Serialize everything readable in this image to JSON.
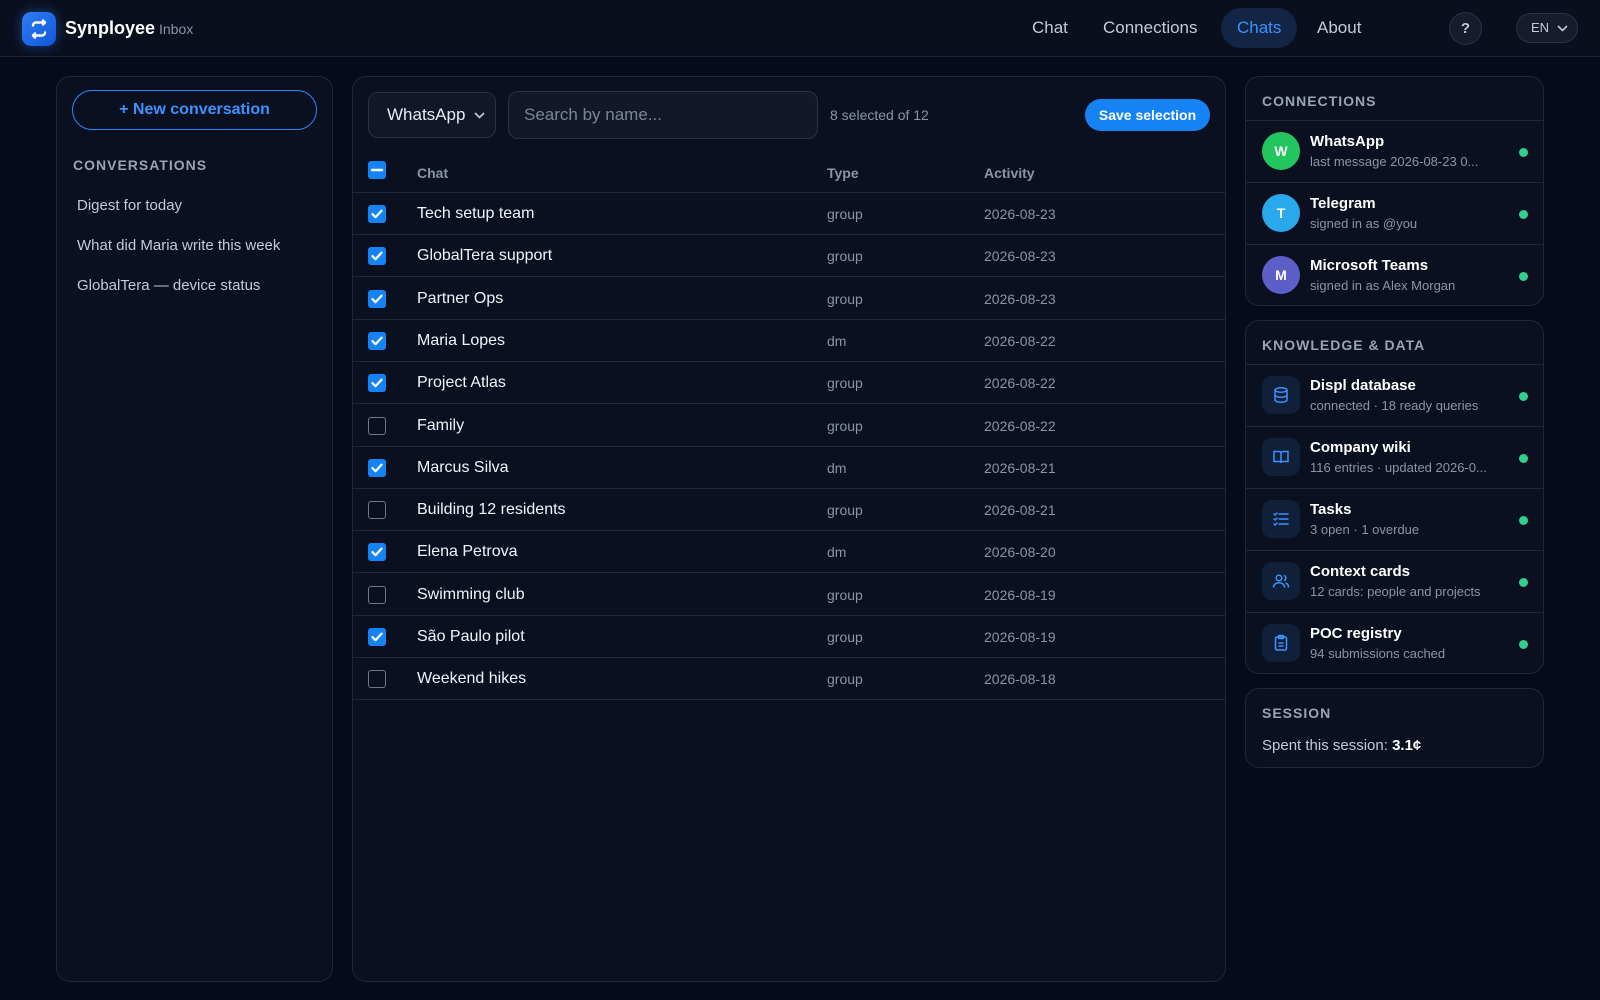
{
  "app": {
    "brand": "Synployee",
    "section": "Inbox"
  },
  "nav": {
    "items": [
      {
        "label": "Chat"
      },
      {
        "label": "Connections"
      },
      {
        "label": "Chats",
        "active": true
      },
      {
        "label": "About"
      }
    ],
    "help_label": "?",
    "lang_label": "EN"
  },
  "left": {
    "new_conversation_label": "+ New conversation",
    "conversations_title": "CONVERSATIONS",
    "conversations": [
      "Digest for today",
      "What did Maria write this week",
      "GlobalTera — device status"
    ]
  },
  "chats": {
    "platform_selected": "WhatsApp",
    "search_placeholder": "Search by name...",
    "selection_text": "8 selected of 12",
    "save_label": "Save selection",
    "columns": {
      "chat": "Chat",
      "type": "Type",
      "activity": "Activity"
    },
    "rows": [
      {
        "name": "Tech setup team",
        "type": "group",
        "activity": "2026-08-23",
        "checked": true
      },
      {
        "name": "GlobalTera support",
        "type": "group",
        "activity": "2026-08-23",
        "checked": true
      },
      {
        "name": "Partner Ops",
        "type": "group",
        "activity": "2026-08-23",
        "checked": true
      },
      {
        "name": "Maria Lopes",
        "type": "dm",
        "activity": "2026-08-22",
        "checked": true
      },
      {
        "name": "Project Atlas",
        "type": "group",
        "activity": "2026-08-22",
        "checked": true
      },
      {
        "name": "Family",
        "type": "group",
        "activity": "2026-08-22",
        "checked": false
      },
      {
        "name": "Marcus Silva",
        "type": "dm",
        "activity": "2026-08-21",
        "checked": true
      },
      {
        "name": "Building 12 residents",
        "type": "group",
        "activity": "2026-08-21",
        "checked": false
      },
      {
        "name": "Elena Petrova",
        "type": "dm",
        "activity": "2026-08-20",
        "checked": true
      },
      {
        "name": "Swimming club",
        "type": "group",
        "activity": "2026-08-19",
        "checked": false
      },
      {
        "name": "São Paulo pilot",
        "type": "group",
        "activity": "2026-08-19",
        "checked": true
      },
      {
        "name": "Weekend hikes",
        "type": "group",
        "activity": "2026-08-18",
        "checked": false
      }
    ]
  },
  "connections": {
    "title": "CONNECTIONS",
    "items": [
      {
        "initial": "W",
        "name": "WhatsApp",
        "detail": "last message 2026-08-23 0...",
        "color": "#22c55e"
      },
      {
        "initial": "T",
        "name": "Telegram",
        "detail": "signed in as @you",
        "color": "#29a9eb"
      },
      {
        "initial": "M",
        "name": "Microsoft Teams",
        "detail": "signed in as Alex Morgan",
        "color": "#5b5fc7"
      }
    ]
  },
  "knowledge": {
    "title": "KNOWLEDGE & DATA",
    "items": [
      {
        "icon": "database-icon",
        "name": "Displ database",
        "detail": "connected · 18 ready queries"
      },
      {
        "icon": "book-icon",
        "name": "Company wiki",
        "detail": "116 entries · updated 2026-0..."
      },
      {
        "icon": "list-icon",
        "name": "Tasks",
        "detail": "3 open · 1 overdue"
      },
      {
        "icon": "people-icon",
        "name": "Context cards",
        "detail": "12 cards: people and projects"
      },
      {
        "icon": "clipboard-icon",
        "name": "POC registry",
        "detail": "94 submissions cached"
      }
    ]
  },
  "session": {
    "title": "SESSION",
    "spent_label": "Spent this session:",
    "spent_value": "3.1¢"
  },
  "colors": {
    "accent": "#1683f5",
    "status_ok": "#2fd08a",
    "background": "#060a1a"
  }
}
